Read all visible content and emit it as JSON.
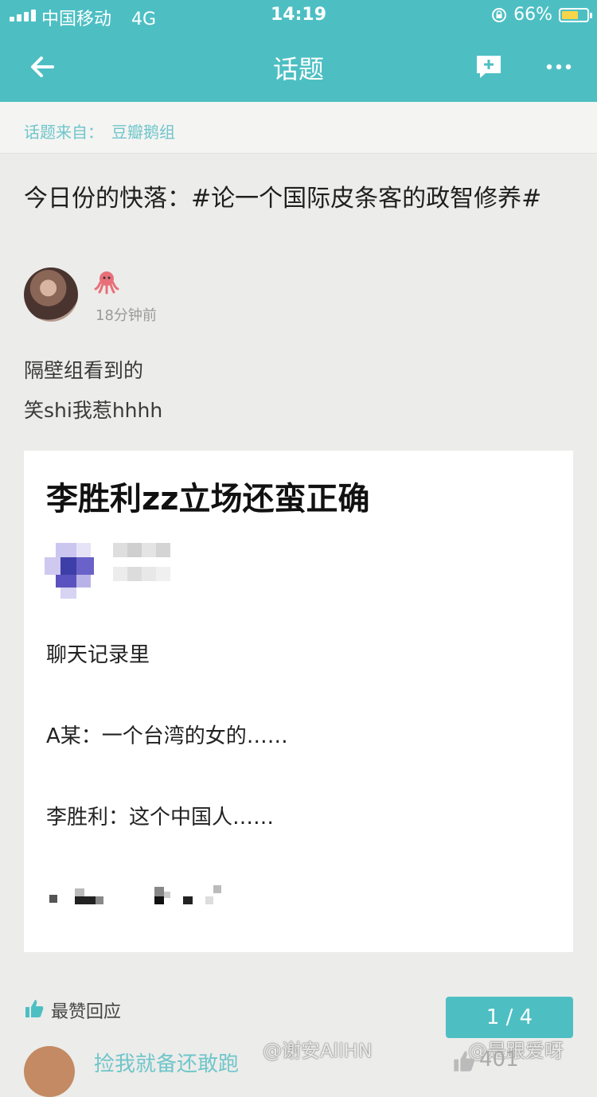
{
  "status_bar": {
    "carrier": "中国移动",
    "network": "4G",
    "time": "14:19",
    "battery": "66%",
    "battery_level": 0.66
  },
  "nav": {
    "title": "话题",
    "back_icon": "arrow-left-icon",
    "compose_icon": "compose-plus-icon",
    "more_icon": "more-dots-icon"
  },
  "source": {
    "label": "话题来自：",
    "group": "豆瓣鹅组"
  },
  "post": {
    "title": "今日份的快落：#论一个国际皮条客的政智修养#",
    "author_badge": "octopus-emoji-icon",
    "time": "18分钟前",
    "body": [
      "隔壁组看到的",
      "笑shi我惹hhhh"
    ]
  },
  "embedded_screenshot": {
    "title": "李胜利zz立场还蛮正确",
    "lines": [
      "聊天记录里",
      "A某：一个台湾的女的……",
      "李胜利：这个中国人……"
    ]
  },
  "footer": {
    "top_replies": "最赞回应",
    "pager": "1 / 4",
    "next_reply_name": "捡我就备还敢跑",
    "next_reply_likes": "401",
    "watermarks": [
      "@谢安AllHN",
      "@是跟爱呀"
    ]
  },
  "colors": {
    "accent": "#4dbfc3",
    "link": "#6fc6ca"
  }
}
